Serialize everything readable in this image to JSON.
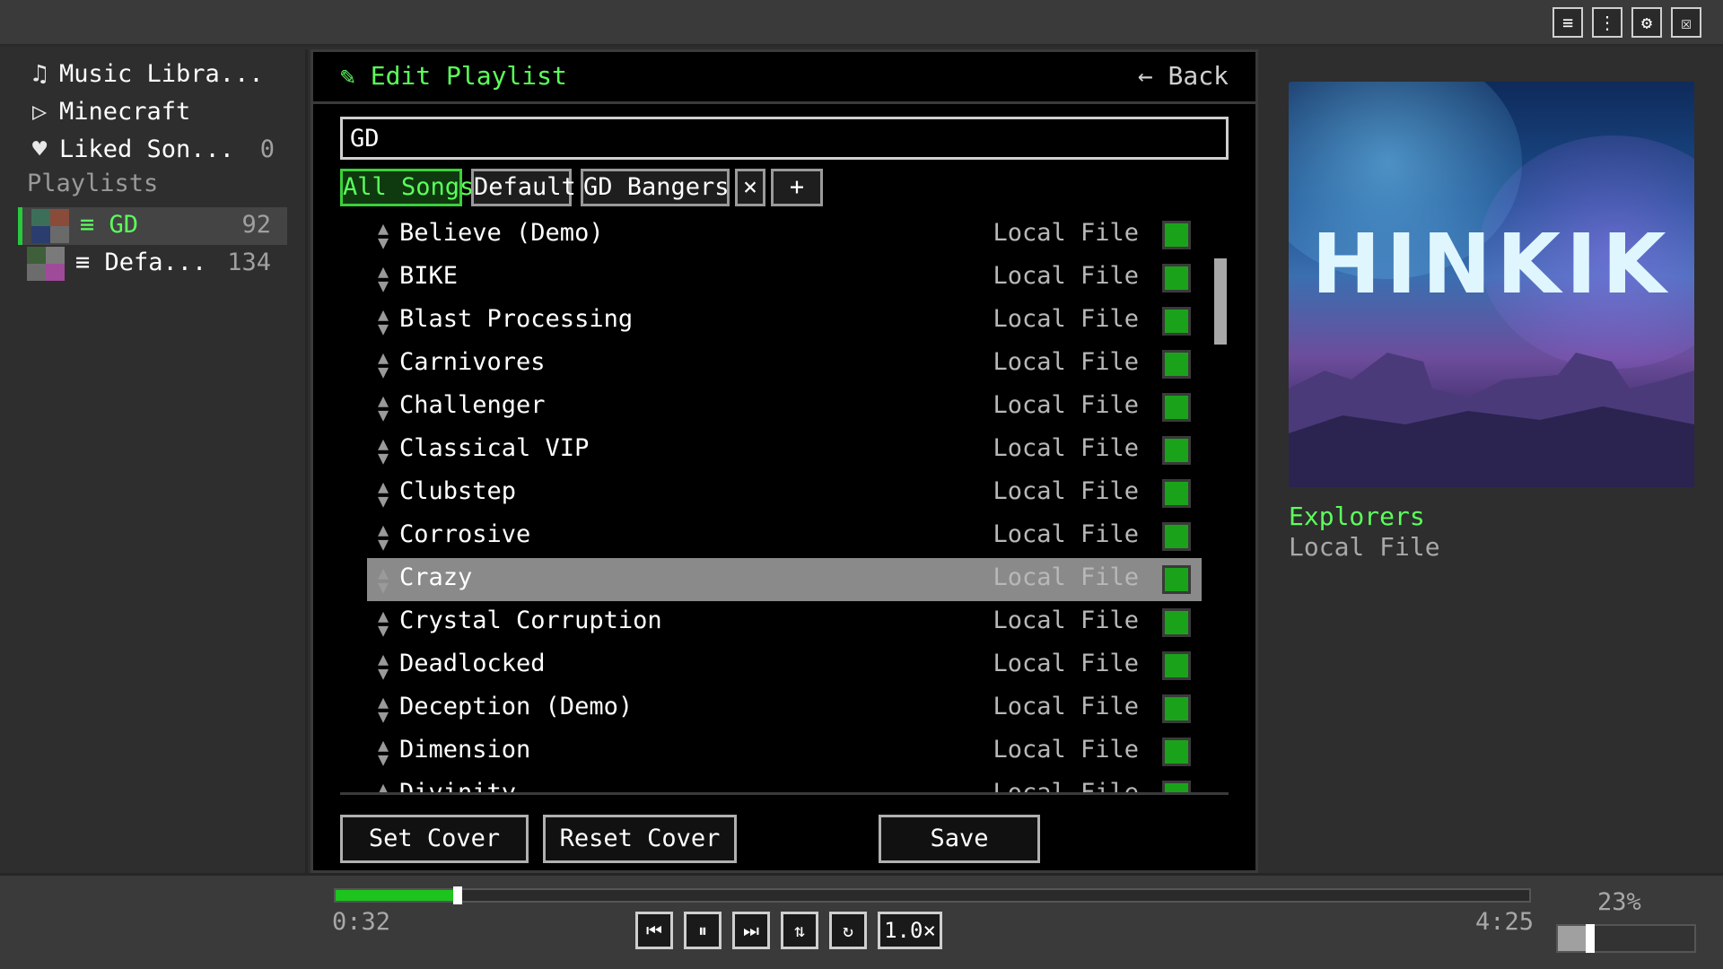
{
  "window_buttons": [
    {
      "name": "menu-icon",
      "glyph": "≡"
    },
    {
      "name": "more-icon",
      "glyph": "⋮"
    },
    {
      "name": "settings-icon",
      "glyph": "⚙"
    },
    {
      "name": "close-icon",
      "glyph": "☒"
    }
  ],
  "sidebar": {
    "items": [
      {
        "icon": "♫",
        "label": "Music Libra...",
        "count": ""
      },
      {
        "icon": "▷",
        "label": "Minecraft",
        "count": ""
      },
      {
        "icon": "♥",
        "label": "Liked Son...",
        "count": "0"
      }
    ],
    "playlists_heading": "Playlists",
    "playlists": [
      {
        "label": "≡ GD",
        "count": "92",
        "selected": true
      },
      {
        "label": "≡ Defa...",
        "count": "134",
        "selected": false
      }
    ]
  },
  "editor": {
    "title": "✎ Edit Playlist",
    "back_label": "← Back",
    "name_value": "GD",
    "tabs": [
      "All Songs",
      "Default",
      "GD Bangers",
      "×",
      "+"
    ],
    "songs": [
      {
        "title": "Believe (Demo)",
        "source": "Local File"
      },
      {
        "title": "BIKE",
        "source": "Local File"
      },
      {
        "title": "Blast Processing",
        "source": "Local File"
      },
      {
        "title": "Carnivores",
        "source": "Local File"
      },
      {
        "title": "Challenger",
        "source": "Local File"
      },
      {
        "title": "Classical VIP",
        "source": "Local File"
      },
      {
        "title": "Clubstep",
        "source": "Local File"
      },
      {
        "title": "Corrosive",
        "source": "Local File"
      },
      {
        "title": "Crazy",
        "source": "Local File"
      },
      {
        "title": "Crystal Corruption",
        "source": "Local File"
      },
      {
        "title": "Deadlocked",
        "source": "Local File"
      },
      {
        "title": "Deception (Demo)",
        "source": "Local File"
      },
      {
        "title": "Dimension",
        "source": "Local File"
      },
      {
        "title": "Divinity",
        "source": "Local File"
      }
    ],
    "highlighted_index": 8,
    "buttons": {
      "set_cover": "Set Cover",
      "reset_cover": "Reset Cover",
      "save": "Save"
    }
  },
  "now_playing": {
    "cover_text": "HINKIK",
    "title": "Explorers",
    "subtitle": "Local File"
  },
  "player": {
    "current_time": "0:32",
    "total_time": "4:25",
    "progress": 0.1,
    "controls": [
      {
        "name": "previous-icon",
        "glyph": "⏮"
      },
      {
        "name": "pause-icon",
        "glyph": "⏸"
      },
      {
        "name": "next-icon",
        "glyph": "⏭"
      },
      {
        "name": "shuffle-icon",
        "glyph": "⇅"
      },
      {
        "name": "repeat-icon",
        "glyph": "↻"
      },
      {
        "name": "speed-button",
        "glyph": "1.0×"
      }
    ],
    "volume_label": "23%",
    "volume": 0.23
  },
  "colors": {
    "accent": "#5cff5c",
    "check": "#1aa31a",
    "progress": "#1dc41d"
  }
}
